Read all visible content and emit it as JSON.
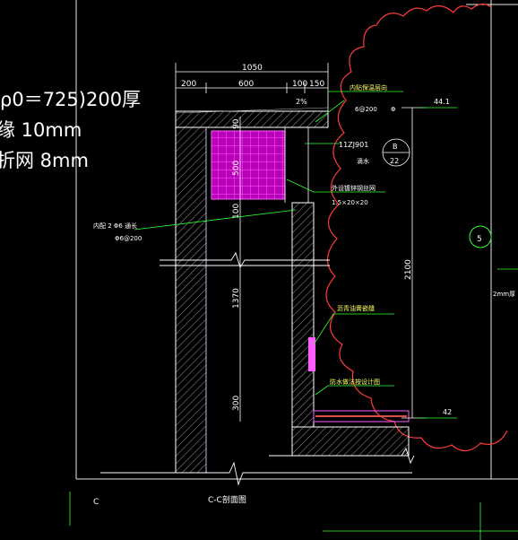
{
  "left_notes": {
    "line1": "ρ0＝725)200厚",
    "line2": "缘 10mm",
    "line3": "折网 8mm"
  },
  "top_dims": {
    "total": "1050",
    "seg1": "200",
    "seg2": "600",
    "seg3": "100",
    "seg4": "150",
    "slope": "2%"
  },
  "vertical_dims": {
    "d90": "90",
    "d500": "500",
    "d100": "100",
    "d1370": "1370",
    "d300": "300",
    "total_right": "2100"
  },
  "callouts": {
    "wall_insulation": "内贴保温层向",
    "rebar_top": "6@200",
    "rebar_sym": "Φ",
    "std_ref": "11ZJ901",
    "std_index_top": "B",
    "std_index_bottom": "22",
    "drip": "滴水",
    "mesh_label": "外设镀锌钢丝网",
    "mesh_spec": "1.5×20×20",
    "left_rebar": "内配 2 Φ6 通长",
    "left_rebar2": "Φ6@200",
    "asphalt": "沥青油膏嵌缝",
    "waterproof": "防水做法按设计图",
    "right_note": "2mm厚"
  },
  "elevations": {
    "top": "44.1",
    "bottom": "42"
  },
  "grid": {
    "axis_label": "5"
  },
  "section": {
    "title": "C-C剖面图",
    "mark": "C"
  }
}
